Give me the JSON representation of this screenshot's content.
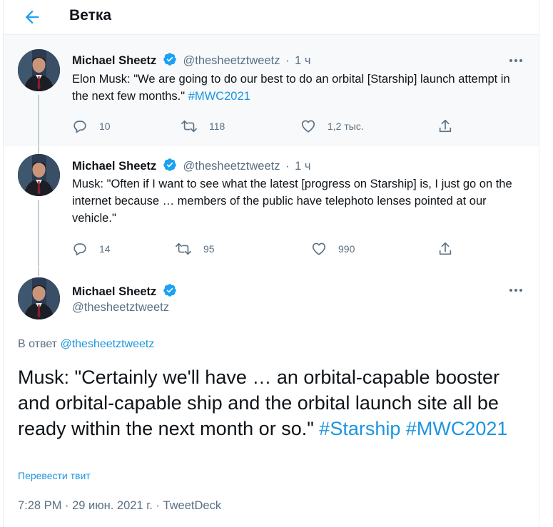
{
  "header": {
    "title": "Ветка",
    "back_icon": "arrow-left-icon"
  },
  "tweets": [
    {
      "name": "Michael Sheetz",
      "handle": "@thesheetztweetz",
      "time": "1 ч",
      "text": "Elon Musk: \"We are going to do our best to do an orbital [Starship] launch attempt in the next few months.\" ",
      "hashtags": [
        "#MWC2021"
      ],
      "replies": "10",
      "retweets": "118",
      "likes": "1,2 тыс."
    },
    {
      "name": "Michael Sheetz",
      "handle": "@thesheetztweetz",
      "time": "1 ч",
      "text": "Musk: \"Often if I want to see what the latest [progress on Starship] is, I just go on the internet because … members of the public have telephoto lenses pointed at our vehicle.\"",
      "replies": "14",
      "retweets": "95",
      "likes": "990"
    }
  ],
  "main": {
    "name": "Michael Sheetz",
    "handle": "@thesheetztweetz",
    "reply_prefix": "В ответ",
    "reply_to": "@thesheetztweetz",
    "text": "Musk: \"Certainly we'll have … an orbital-capable booster and orbital-capable ship and the orbital launch site all be ready within the next month or so.\" ",
    "hashtags": [
      "#Starship",
      "#MWC2021"
    ],
    "translate": "Перевести твит",
    "meta": "7:28 PM · 29 июн. 2021 г. · TweetDeck"
  },
  "colors": {
    "accent": "#1da1f2",
    "link": "#1b95e0",
    "secondary": "#5b7083",
    "hover_bg": "#f7f9fa"
  }
}
